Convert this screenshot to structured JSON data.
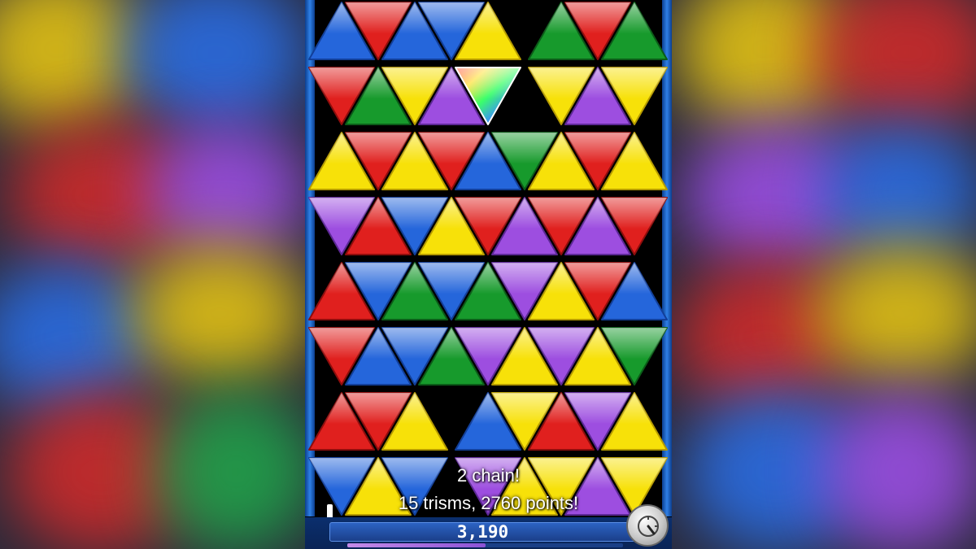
{
  "colors": {
    "red": "#e0201e",
    "blue": "#2566db",
    "yellow": "#f7e109",
    "green": "#179a2c",
    "purple": "#9d4ee0",
    "prism": "#ffffff"
  },
  "board": {
    "rows": [
      [
        "blue",
        "red",
        "blue",
        "blue",
        "yellow",
        "empty",
        "green",
        "red",
        "green"
      ],
      [
        "red",
        "green",
        "yellow",
        "purple",
        "prism",
        "empty",
        "yellow",
        "purple",
        "yellow"
      ],
      [
        "yellow",
        "red",
        "yellow",
        "red",
        "blue",
        "green",
        "yellow",
        "red",
        "yellow"
      ],
      [
        "purple",
        "red",
        "blue",
        "yellow",
        "red",
        "purple",
        "red",
        "purple",
        "red"
      ],
      [
        "red",
        "blue",
        "green",
        "blue",
        "green",
        "purple",
        "yellow",
        "red",
        "blue"
      ],
      [
        "red",
        "blue",
        "blue",
        "green",
        "purple",
        "yellow",
        "purple",
        "yellow",
        "green"
      ],
      [
        "red",
        "red",
        "yellow",
        "empty",
        "blue",
        "yellow",
        "red",
        "purple",
        "yellow"
      ],
      [
        "blue",
        "yellow",
        "blue",
        "empty",
        "purple",
        "yellow",
        "yellow",
        "purple",
        "yellow"
      ]
    ]
  },
  "messages": {
    "chain": "2 chain!",
    "points": "15 trisms, 2760 points!"
  },
  "hud": {
    "score": "3,190",
    "progress": 0.5
  },
  "icons": {
    "menu": "timer-dial-icon",
    "level": "level-marker-icon"
  }
}
